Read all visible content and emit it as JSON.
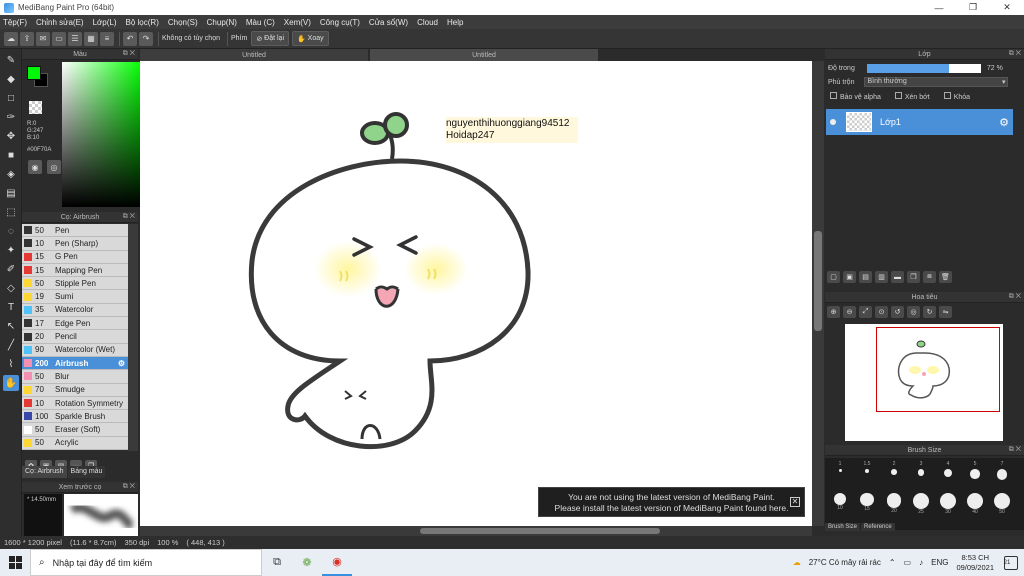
{
  "window": {
    "title": "MediBang Paint Pro (64bit)",
    "controls": [
      "—",
      "❐",
      "✕"
    ]
  },
  "menu": [
    "Tệp(F)",
    "Chỉnh sửa(E)",
    "Lớp(L)",
    "Bộ lọc(R)",
    "Chọn(S)",
    "Chụp(N)",
    "Màu (C)",
    "Xem(V)",
    "Công cụ(T)",
    "Cửa sổ(W)",
    "Cloud",
    "Help"
  ],
  "toolbar": {
    "no_option": "Không có tùy chọn",
    "phim": "Phím",
    "reset": "Đặt lại",
    "rotate": "Xoay"
  },
  "color_panel": {
    "title": "Màu",
    "foreground": "#00F70A",
    "r": "R:0",
    "g": "G:247",
    "b": "B:10",
    "hex": "#00F70A"
  },
  "brush_panel": {
    "title": "Cọ: Airbrush",
    "brushes": [
      {
        "size": "50",
        "name": "Pen",
        "color": "#333333"
      },
      {
        "size": "10",
        "name": "Pen (Sharp)",
        "color": "#333333"
      },
      {
        "size": "15",
        "name": "G Pen",
        "color": "#e53935"
      },
      {
        "size": "15",
        "name": "Mapping Pen",
        "color": "#e53935"
      },
      {
        "size": "50",
        "name": "Stipple Pen",
        "color": "#fdd835"
      },
      {
        "size": "19",
        "name": "Sumi",
        "color": "#fdd835"
      },
      {
        "size": "35",
        "name": "Watercolor",
        "color": "#4fc3f7"
      },
      {
        "size": "17",
        "name": "Edge Pen",
        "color": "#333333"
      },
      {
        "size": "20",
        "name": "Pencil",
        "color": "#333333"
      },
      {
        "size": "90",
        "name": "Watercolor (Wet)",
        "color": "#4fc3f7"
      },
      {
        "size": "200",
        "name": "Airbrush",
        "color": "#f48fb1",
        "selected": true
      },
      {
        "size": "50",
        "name": "Blur",
        "color": "#f48fb1"
      },
      {
        "size": "70",
        "name": "Smudge",
        "color": "#fdd835"
      },
      {
        "size": "10",
        "name": "Rotation Symmetry",
        "color": "#e53935"
      },
      {
        "size": "100",
        "name": "Sparkle Brush",
        "color": "#3949ab"
      },
      {
        "size": "50",
        "name": "Eraser (Soft)",
        "color": "#ffffff"
      },
      {
        "size": "50",
        "name": "Acrylic",
        "color": "#fdd835"
      }
    ],
    "tab_brush": "Cọ: Airbrush",
    "tab_palette": "Bảng màu"
  },
  "preview": {
    "title": "Xem trước cọ",
    "size": "* 14.50mm"
  },
  "documents": [
    "Untitled",
    "Untitled"
  ],
  "canvas": {
    "signature_line1": "nguyenthihuonggiang94512",
    "signature_line2": "Hoidap247"
  },
  "notice": {
    "line1": "You are not using the latest version of MediBang Paint.",
    "line2": "Please install the latest version of MediBang Paint found here."
  },
  "layer_panel": {
    "title": "Lớp",
    "opacity_label": "Độ trong",
    "opacity_value": "72 %",
    "opacity_fraction": 0.72,
    "blend_label": "Phủ trộn",
    "blend_value": "Bình thường",
    "protect_alpha": "Bảo vệ alpha",
    "clipping": "Xén bớt",
    "lock": "Khóa",
    "layer_name": "Lớp1"
  },
  "navigator": {
    "title": "Hoa tiêu"
  },
  "brush_size": {
    "title": "Brush Size",
    "row1": [
      "1",
      "1.5",
      "2",
      "3",
      "4",
      "5",
      "7"
    ],
    "row2": [
      "10",
      "15",
      "20",
      "25",
      "30",
      "40",
      "50"
    ],
    "tabs": [
      "Brush Size",
      "Reference"
    ]
  },
  "status": {
    "size": "1600 * 1200 pixel",
    "cm": "(11.6 * 8.7cm)",
    "dpi": "350 dpi",
    "zoom": "100 %",
    "coords": "( 448, 413 )"
  },
  "taskbar": {
    "search": "Nhập tại đây để tìm kiếm",
    "weather": "27°C  Có mây rải rác",
    "lang": "ENG",
    "time": "8:53 CH",
    "date": "09/09/2021",
    "notifications": "21"
  }
}
